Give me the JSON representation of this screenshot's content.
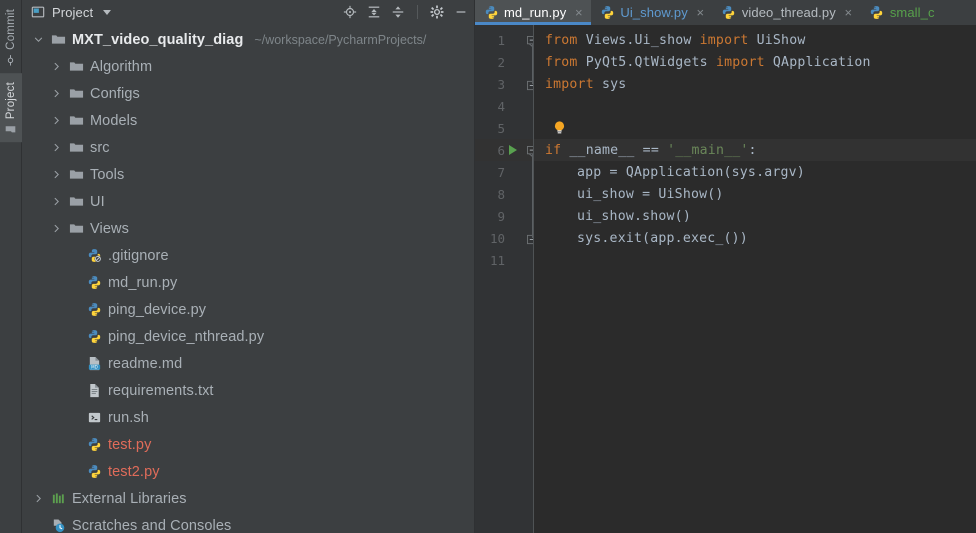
{
  "rail": {
    "items": [
      {
        "label": "Commit",
        "icon": "commit-icon",
        "selected": false
      },
      {
        "label": "Project",
        "icon": "folder-icon",
        "selected": true
      }
    ]
  },
  "project_panel": {
    "title": "Project",
    "dropdown_icon": "chevron-down-icon",
    "toolbar": [
      {
        "name": "select-opened-file-icon",
        "label": "Select Opened File"
      },
      {
        "name": "expand-all-icon",
        "label": "Expand All"
      },
      {
        "name": "collapse-all-icon",
        "label": "Collapse All"
      },
      {
        "name": "settings-gear-icon",
        "label": "Options"
      },
      {
        "name": "hide-icon",
        "label": "Hide"
      }
    ],
    "tree": [
      {
        "label": "MXT_video_quality_diag",
        "sub": "~/workspace/PycharmProjects/",
        "icon": "folder-icon",
        "indent": 0,
        "expanded": true,
        "kind": "root"
      },
      {
        "label": "Algorithm",
        "icon": "folder-icon",
        "indent": 1,
        "expanded": false,
        "kind": "dir"
      },
      {
        "label": "Configs",
        "icon": "folder-icon",
        "indent": 1,
        "expanded": false,
        "kind": "dir"
      },
      {
        "label": "Models",
        "icon": "folder-icon",
        "indent": 1,
        "expanded": false,
        "kind": "dir"
      },
      {
        "label": "src",
        "icon": "folder-icon",
        "indent": 1,
        "expanded": false,
        "kind": "dir"
      },
      {
        "label": "Tools",
        "icon": "folder-icon",
        "indent": 1,
        "expanded": false,
        "kind": "dir"
      },
      {
        "label": "UI",
        "icon": "folder-icon",
        "indent": 1,
        "expanded": false,
        "kind": "dir"
      },
      {
        "label": "Views",
        "icon": "folder-icon",
        "indent": 1,
        "expanded": false,
        "kind": "dir"
      },
      {
        "label": ".gitignore",
        "icon": "gitignore-file-icon",
        "indent": 2,
        "kind": "file"
      },
      {
        "label": "md_run.py",
        "icon": "python-file-icon",
        "indent": 2,
        "kind": "file"
      },
      {
        "label": "ping_device.py",
        "icon": "python-file-icon",
        "indent": 2,
        "kind": "file"
      },
      {
        "label": "ping_device_nthread.py",
        "icon": "python-file-icon",
        "indent": 2,
        "kind": "file"
      },
      {
        "label": "readme.md",
        "icon": "markdown-file-icon",
        "indent": 2,
        "kind": "file"
      },
      {
        "label": "requirements.txt",
        "icon": "text-file-icon",
        "indent": 2,
        "kind": "file"
      },
      {
        "label": "run.sh",
        "icon": "shell-file-icon",
        "indent": 2,
        "kind": "file"
      },
      {
        "label": "test.py",
        "icon": "python-file-icon",
        "indent": 2,
        "kind": "file",
        "color": "red"
      },
      {
        "label": "test2.py",
        "icon": "python-file-icon",
        "indent": 2,
        "kind": "file",
        "color": "red"
      },
      {
        "label": "External Libraries",
        "icon": "external-libraries-icon",
        "indent": 0,
        "expanded": false,
        "kind": "node"
      },
      {
        "label": "Scratches and Consoles",
        "icon": "scratches-icon",
        "indent": 0,
        "kind": "node"
      }
    ]
  },
  "editor": {
    "tabs": [
      {
        "label": "md_run.py",
        "icon": "python-file-icon",
        "active": true,
        "color": "white",
        "close_label": "×"
      },
      {
        "label": "Ui_show.py",
        "icon": "python-file-icon",
        "active": false,
        "color": "blue",
        "close_label": "×"
      },
      {
        "label": "video_thread.py",
        "icon": "python-file-icon",
        "active": false,
        "color": "gray",
        "close_label": "×"
      },
      {
        "label": "small_c",
        "icon": "python-file-icon",
        "active": false,
        "color": "green",
        "close_label": "×"
      }
    ],
    "caret_line": 6,
    "run_marker_line": 6,
    "bulb_line": 5,
    "lines": [
      {
        "n": "1",
        "indent": 0,
        "fold": "open",
        "tokens": [
          {
            "t": "from",
            "c": "kw"
          },
          {
            "t": " Views.Ui_show ",
            "c": "pl"
          },
          {
            "t": "import",
            "c": "kw"
          },
          {
            "t": " UiShow",
            "c": "pl"
          }
        ]
      },
      {
        "n": "2",
        "indent": 0,
        "fold": "",
        "tokens": [
          {
            "t": "from",
            "c": "kw"
          },
          {
            "t": " PyQt5.QtWidgets ",
            "c": "pl"
          },
          {
            "t": "import",
            "c": "kw"
          },
          {
            "t": " QApplication",
            "c": "pl"
          }
        ]
      },
      {
        "n": "3",
        "indent": 0,
        "fold": "end",
        "tokens": [
          {
            "t": "import",
            "c": "kw"
          },
          {
            "t": " sys",
            "c": "pl"
          }
        ]
      },
      {
        "n": "4",
        "indent": 0,
        "fold": "",
        "tokens": []
      },
      {
        "n": "5",
        "indent": 0,
        "fold": "",
        "tokens": []
      },
      {
        "n": "6",
        "indent": 0,
        "fold": "open",
        "tokens": [
          {
            "t": "if",
            "c": "kw"
          },
          {
            "t": " __name__ == ",
            "c": "pl"
          },
          {
            "t": "'__main__'",
            "c": "str"
          },
          {
            "t": ":",
            "c": "pl"
          }
        ]
      },
      {
        "n": "7",
        "indent": 1,
        "fold": "",
        "tokens": [
          {
            "t": "app = QApplication(sys.argv)",
            "c": "pl"
          }
        ]
      },
      {
        "n": "8",
        "indent": 1,
        "fold": "",
        "tokens": [
          {
            "t": "ui_show = UiShow()",
            "c": "pl"
          }
        ]
      },
      {
        "n": "9",
        "indent": 1,
        "fold": "",
        "tokens": [
          {
            "t": "ui_show.show()",
            "c": "pl"
          }
        ]
      },
      {
        "n": "10",
        "indent": 1,
        "fold": "end",
        "tokens": [
          {
            "t": "sys.exit(app.exec_())",
            "c": "pl"
          }
        ]
      },
      {
        "n": "11",
        "indent": 0,
        "fold": "",
        "tokens": []
      }
    ]
  },
  "colors": {
    "panel_bg": "#3c3f41",
    "editor_bg": "#2b2b2b",
    "gutter_bg": "#313335",
    "caret_line_bg": "#323232",
    "accent_blue": "#4a88c7",
    "keyword_orange": "#cc7832",
    "string_green": "#6a8759",
    "plain_text": "#a9b7c6",
    "unversioned_red": "#e06c5a",
    "tab_green": "#57a14b",
    "tab_blue": "#5f9ad0"
  }
}
